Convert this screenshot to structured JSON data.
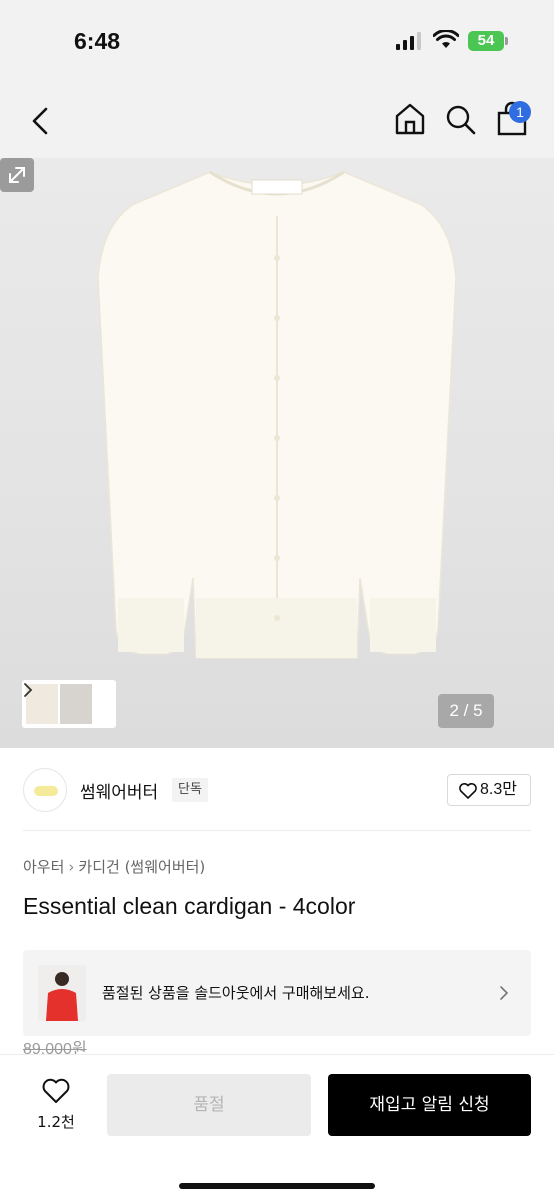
{
  "status_bar": {
    "time": "6:48",
    "battery": "54"
  },
  "nav": {
    "back_icon": "chevron-left-icon",
    "home_icon": "home-icon",
    "search_icon": "search-icon",
    "cart_icon": "shopping-bag-icon",
    "cart_count": "1"
  },
  "gallery": {
    "page_indicator": "2 / 5",
    "expand_icon": "expand-arrow-icon",
    "thumb_chevron_icon": "chevron-right-icon"
  },
  "brand": {
    "name": "썸웨어버터",
    "tag": "단독",
    "like_icon": "heart-outline-icon",
    "like_count": "8.3만"
  },
  "breadcrumb": {
    "items": [
      "아우터",
      "카디건 (썸웨어버터)"
    ]
  },
  "product": {
    "title": "Essential clean cardigan - 4color",
    "original_price": "89,000원"
  },
  "soldout_banner": {
    "text": "품절된 상품을 솔드아웃에서 구매해보세요.",
    "chevron_icon": "chevron-right-icon"
  },
  "bottom_bar": {
    "wish_icon": "heart-outline-icon",
    "wish_count": "1.2천",
    "soldout_label": "품절",
    "restock_label": "재입고 알림 신청"
  },
  "colors": {
    "accent_badge": "#2f6de1",
    "battery": "#4cc652",
    "primary_button": "#000000"
  }
}
